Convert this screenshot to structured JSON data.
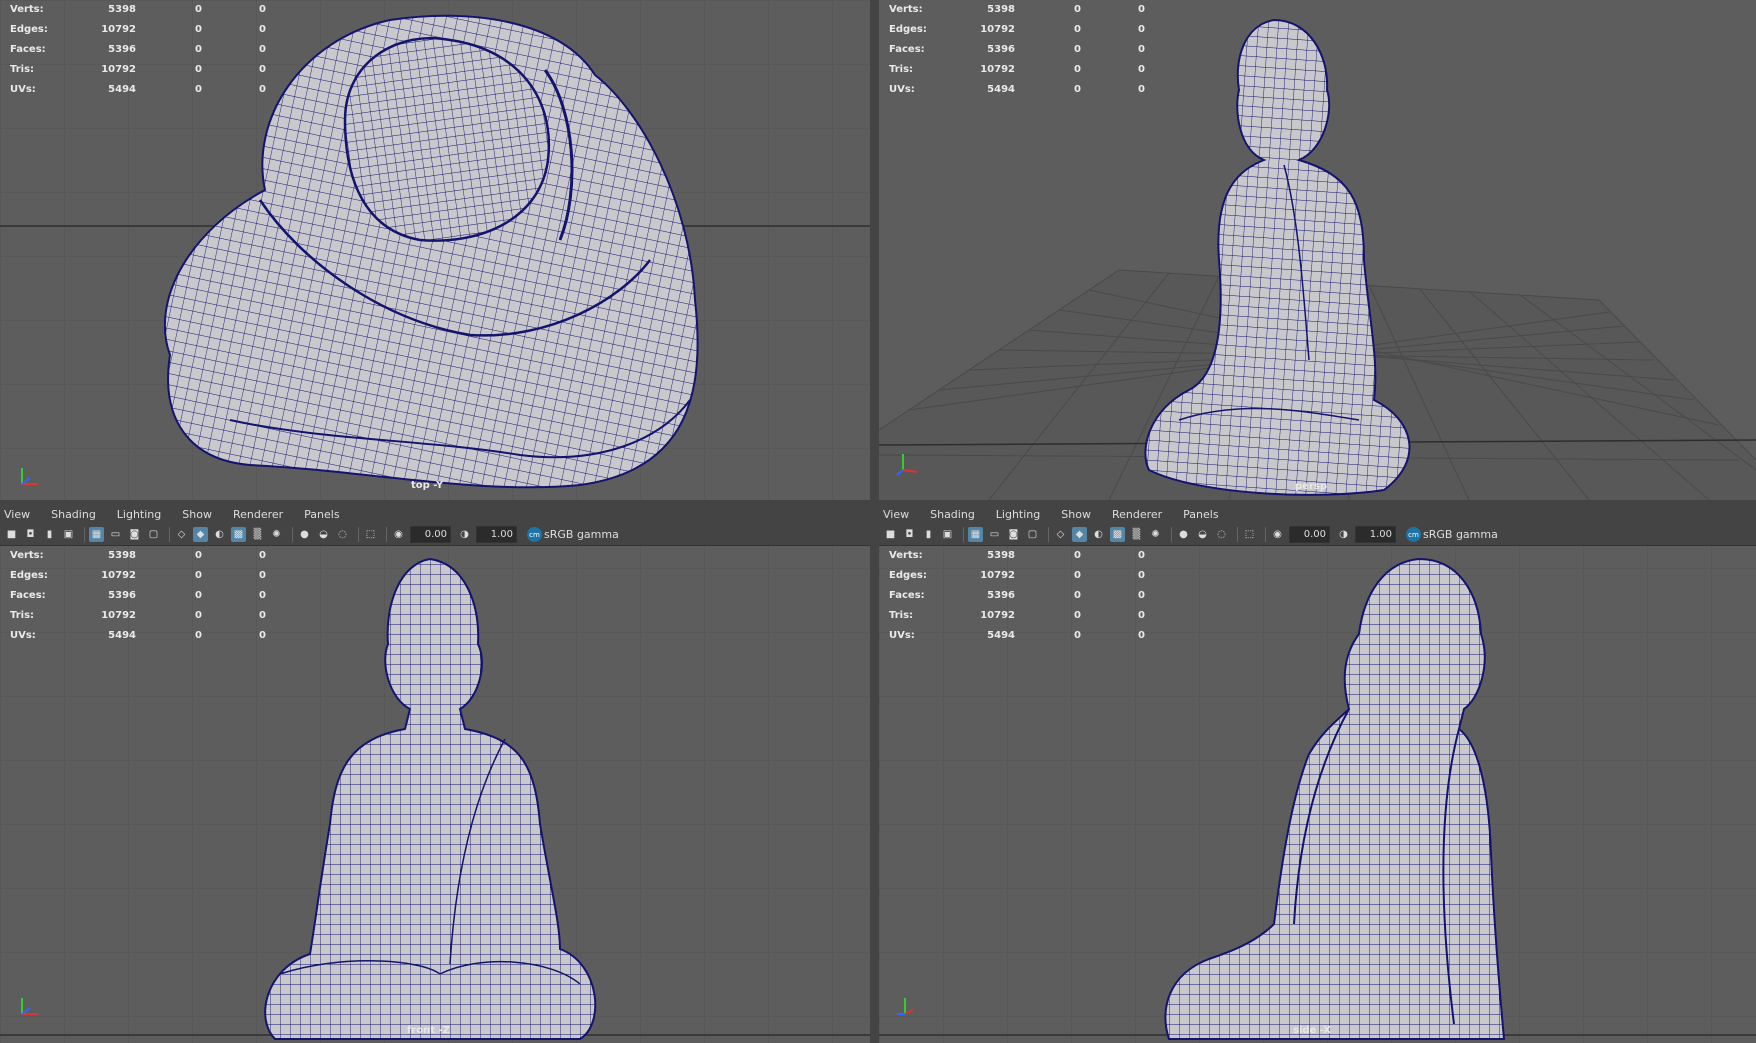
{
  "stats": {
    "labels": [
      "Verts:",
      "Edges:",
      "Faces:",
      "Tris:",
      "UVs:"
    ],
    "values": [
      "5398",
      "10792",
      "5396",
      "10792",
      "5494"
    ],
    "zero_a": "0",
    "zero_b": "0"
  },
  "menus": [
    "View",
    "Shading",
    "Lighting",
    "Show",
    "Renderer",
    "Panels"
  ],
  "toolbar": {
    "exposure": "0.00",
    "gamma_value": "1.00",
    "color_space": "sRGB gamma"
  },
  "panels": {
    "top": {
      "camera_label": "top -Y"
    },
    "persp": {
      "camera_label": "persp"
    },
    "front": {
      "camera_label": "front -Z"
    },
    "side": {
      "camera_label": "side -X"
    }
  },
  "colors": {
    "viewport_bg": "#5d5d5d",
    "grid": "#505050",
    "wire": "#14146e",
    "mesh_fill": "#c9c9cd",
    "accent": "#5285a6"
  },
  "icons": {
    "toolbar": [
      "camera-icon",
      "camera-attr-icon",
      "bookmark-icon",
      "image-plane-icon",
      "grid-toggle-icon",
      "film-gate-icon",
      "resolution-gate-icon",
      "wireframe-icon",
      "smooth-shade-icon",
      "textured-icon",
      "lights-icon",
      "shadows-icon",
      "xray-icon",
      "isolate-icon",
      "exposure-icon",
      "gamma-icon",
      "color-management-icon"
    ]
  }
}
